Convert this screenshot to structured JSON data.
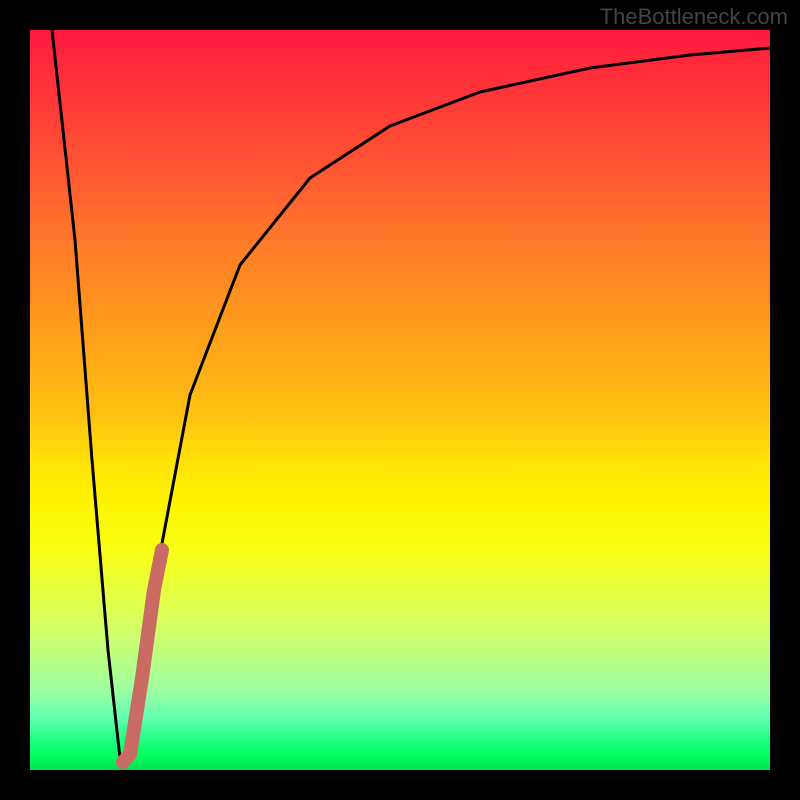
{
  "watermark": "TheBottleneck.com",
  "chart_data": {
    "type": "line",
    "title": "",
    "xlabel": "",
    "ylabel": "",
    "xlim": [
      0,
      100
    ],
    "ylim": [
      0,
      100
    ],
    "series": [
      {
        "name": "main-curve",
        "x": [
          3,
          5,
          7,
          9,
          11,
          12,
          13,
          14,
          16,
          20,
          26,
          34,
          44,
          56,
          70,
          85,
          100
        ],
        "y": [
          100,
          69,
          40,
          13,
          0,
          1,
          4,
          12,
          30,
          54,
          71,
          81,
          87,
          91,
          94,
          96,
          97
        ]
      },
      {
        "name": "highlight-segment",
        "x": [
          12,
          13,
          14,
          15,
          16
        ],
        "y": [
          1,
          4,
          12,
          21,
          30
        ]
      }
    ],
    "annotations": []
  }
}
